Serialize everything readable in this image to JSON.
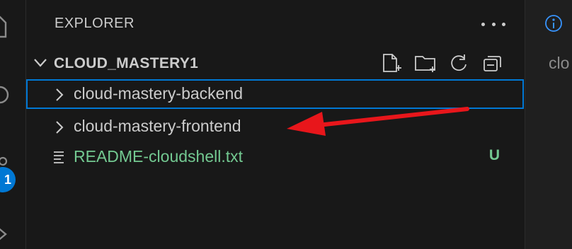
{
  "sidebar": {
    "title": "EXPLORER",
    "section_title": "CLOUD_MASTERY1",
    "tree": [
      {
        "label": "cloud-mastery-backend",
        "type": "folder",
        "selected": true
      },
      {
        "label": "cloud-mastery-frontend",
        "type": "folder",
        "selected": false
      },
      {
        "label": "README-cloudshell.txt",
        "type": "file",
        "status": "U"
      }
    ],
    "section_actions": [
      "new-file-icon",
      "new-folder-icon",
      "refresh-icon",
      "collapse-all-icon"
    ]
  },
  "activity_bar": {
    "badge": "1",
    "icons": [
      "explorer-icon",
      "search-icon",
      "source-control-icon",
      "run-debug-icon"
    ]
  },
  "editor": {
    "text": "clo"
  },
  "colors": {
    "background": "#181818",
    "selection_border": "#0078d4",
    "untracked": "#73c991",
    "annotation_arrow": "#e8161b"
  }
}
